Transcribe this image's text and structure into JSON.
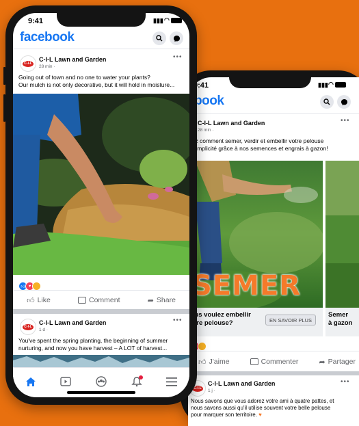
{
  "colors": {
    "background": "#e8700f",
    "brand": "#1877f2"
  },
  "phone_left": {
    "status_time": "9:41",
    "app_logo": "facebook",
    "post1": {
      "page_name": "C-I-L Lawn and Garden",
      "time": "28 min · ",
      "text_lines": [
        "Going out of town and no one to water your plants?",
        "Our mulch is not only decorative, but it will hold in moisture..."
      ],
      "actions": {
        "like": "Like",
        "comment": "Comment",
        "share": "Share"
      }
    },
    "post2": {
      "page_name": "C-I-L Lawn and Garden",
      "time": "1 d · ",
      "text_lines": [
        "You've spent the spring planting, the beginning of summer",
        "nurturing, and now you have harvest – A LOT of harvest..."
      ]
    },
    "tabbar": [
      "home-icon",
      "watch-icon",
      "groups-icon",
      "notifications-icon",
      "menu-icon"
    ]
  },
  "phone_right": {
    "status_time": "9:41",
    "app_logo": "facebook",
    "post1": {
      "page_name": "C-I-L Lawn and Garden",
      "time": "28 min · ",
      "text_lines": [
        "Découvrez comment semer, verdir et embellir votre pelouse",
        "en toute simplicité grâce à nos semences et engrais à gazon!"
      ],
      "card1": {
        "overlay": "SEMER",
        "headline_lines": [
          "Vous voulez embellir",
          "votre pelouse?"
        ],
        "cta": "EN SAVOIR PLUS"
      },
      "card2": {
        "headline_lines": [
          "Semer",
          "à gazon"
        ]
      },
      "actions": {
        "like": "J'aime",
        "comment": "Commenter",
        "share": "Partager"
      }
    },
    "post2": {
      "page_name": "C-I-L Lawn and Garden",
      "time": "1 j · ",
      "text_lines": [
        "Nous savons que vous adorez votre ami à quatre pattes, et",
        "nous savons aussi qu'il utilise souvent votre belle pelouse",
        "pour marquer son territoire. "
      ]
    }
  }
}
